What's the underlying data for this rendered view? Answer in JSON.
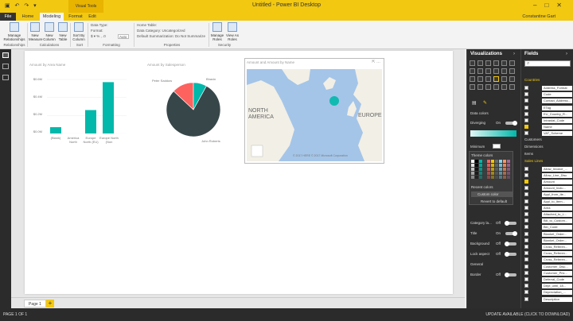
{
  "window": {
    "title": "Untitled - Power BI Desktop",
    "context_tab": "Visual Tools",
    "user": "Constantine Gart"
  },
  "menu": {
    "tabs": [
      "File",
      "Home",
      "Modeling",
      "Format",
      "Edit"
    ],
    "active": "Modeling"
  },
  "ribbon": {
    "buttons": [
      {
        "label": "Manage Relationships"
      },
      {
        "label": "New Measure"
      },
      {
        "label": "New Column"
      },
      {
        "label": "New Table"
      },
      {
        "label": "Sort By Column"
      },
      {
        "label": "Manage Roles"
      },
      {
        "label": "View As Roles"
      }
    ],
    "formatting": {
      "data_type": "Data Type:",
      "format": "Format:",
      "auto": "Auto"
    },
    "properties": {
      "home_table": "Home Table:",
      "data_category": "Data Category: Uncategorized",
      "default_summarization": "Default Summarization: Do Not Summarize"
    },
    "groups": [
      "Relationships",
      "Calculations",
      "Sort",
      "Formatting",
      "Properties",
      "Security"
    ]
  },
  "visuals": {
    "bar": {
      "title": "Amount by Area Name",
      "y_ticks": [
        "$0.6M",
        "$0.4M",
        "$0.2M",
        "$0.0M"
      ],
      "categories": [
        "(Blank)",
        "America North",
        "Europe North (EU)",
        "Europe North (Non"
      ]
    },
    "pie": {
      "title": "Amount by Salesperson",
      "labels": {
        "a": "Peter Saddow",
        "b": "Bhavin",
        "c": "John Roberts"
      }
    },
    "map": {
      "title": "Amount and Amount by Name",
      "labels": {
        "na": "NORTH\nAMERICA",
        "eu": "EUROPE"
      },
      "credit": "© 2017 HERE  © 2017 Microsoft Corporation"
    }
  },
  "chart_data": [
    {
      "type": "bar",
      "title": "Amount by Area Name",
      "categories": [
        "(Blank)",
        "America North",
        "Europe North (EU)",
        "Europe North (Non"
      ],
      "values": [
        0.07,
        0.0,
        0.26,
        0.57
      ],
      "ylabel": "",
      "ylim": [
        0,
        0.6
      ],
      "color": "#01b8aa"
    },
    {
      "type": "pie",
      "title": "Amount by Salesperson",
      "categories": [
        "John Roberts",
        "Peter Saddow",
        "Bhavin"
      ],
      "values": [
        79,
        13,
        8
      ],
      "colors": [
        "#374649",
        "#fd625e",
        "#01b8aa"
      ]
    }
  ],
  "pages": {
    "tabs": [
      "Page 1"
    ],
    "add": "+"
  },
  "viz_pane": {
    "title": "Visualizations",
    "data_colors": "Data colors",
    "diverging": "Diverging",
    "on": "On",
    "minimum": "Minimum",
    "theme_colors": "Theme colors",
    "recent_colors": "Recent colors",
    "custom_color": "Custom color",
    "revert": "Revert to default",
    "props": [
      {
        "label": "Category la...",
        "state": "Off"
      },
      {
        "label": "Title",
        "state": "On"
      },
      {
        "label": "Background",
        "state": "Off"
      },
      {
        "label": "Lock aspect",
        "state": "Off"
      },
      {
        "label": "General",
        "state": ""
      },
      {
        "label": "Border",
        "state": "Off"
      }
    ]
  },
  "fields_pane": {
    "title": "Fields",
    "tables": [
      "Countries",
      "Customers",
      "Dimensions",
      "Items",
      "Sales Lines"
    ],
    "country_fields": [
      {
        "name": "Address_Format",
        "checked": false
      },
      {
        "name": "Code",
        "checked": false
      },
      {
        "name": "Contact_Address...",
        "checked": false
      },
      {
        "name": "ETag",
        "checked": false
      },
      {
        "name": "EU_Country_R...",
        "checked": false
      },
      {
        "name": "Intrastat_Code",
        "checked": false
      },
      {
        "name": "Name",
        "checked": true
      },
      {
        "name": "VAT_Scheme",
        "checked": false
      }
    ],
    "sales_fields": [
      {
        "name": "Allow_Invoice_...",
        "checked": false
      },
      {
        "name": "Allow_Line_Disc",
        "checked": false
      },
      {
        "name": "Amount",
        "checked": true
      },
      {
        "name": "Amount_Inclu...",
        "checked": false
      },
      {
        "name": "Appl_from_Ite...",
        "checked": false
      },
      {
        "name": "Appl_to_Item...",
        "checked": false
      },
      {
        "name": "Area",
        "checked": false
      },
      {
        "name": "Attached_to_L...",
        "checked": false
      },
      {
        "name": "Bill_to_Custom...",
        "checked": false
      },
      {
        "name": "Bin_Code",
        "checked": false
      },
      {
        "name": "Blanket_Order...",
        "checked": false
      },
      {
        "name": "Blanket_Order...",
        "checked": false
      },
      {
        "name": "Cross_Referen...",
        "checked": false
      },
      {
        "name": "Cross_Referen...",
        "checked": false
      },
      {
        "name": "Cross_Referen...",
        "checked": false
      },
      {
        "name": "Customer_Disc...",
        "checked": false
      },
      {
        "name": "Customer_Pric...",
        "checked": false
      },
      {
        "name": "Deferral_Code",
        "checked": false
      },
      {
        "name": "Dept_until_18...",
        "checked": false
      },
      {
        "name": "Depreciation_...",
        "checked": false
      },
      {
        "name": "Description",
        "checked": false
      }
    ]
  },
  "status": {
    "left": "PAGE 1 OF 1",
    "right": "UPDATE AVAILABLE (CLICK TO DOWNLOAD)"
  },
  "colors": {
    "accent": "#f2c811",
    "teal": "#01b8aa",
    "dark": "#374649",
    "red": "#fd625e"
  }
}
